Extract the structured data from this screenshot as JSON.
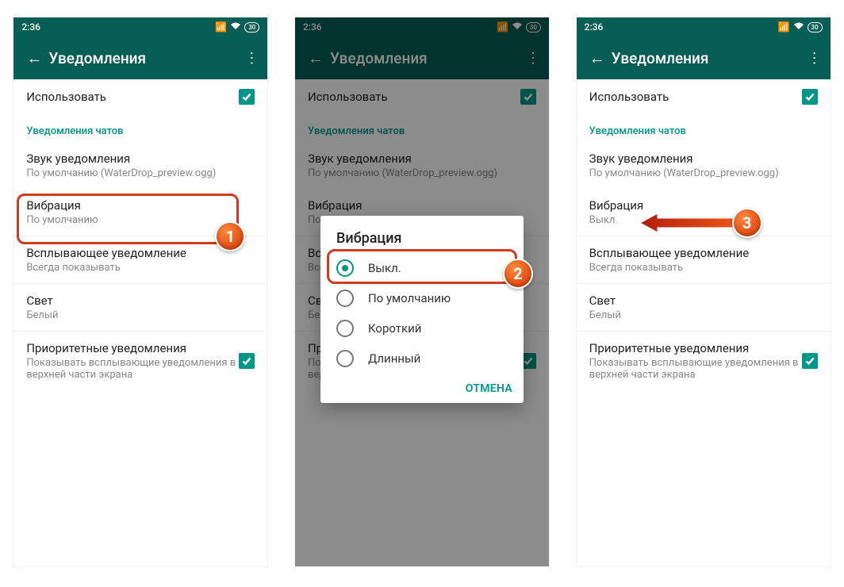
{
  "status": {
    "time": "2:36",
    "battery": "30"
  },
  "appbar": {
    "title": "Уведомления"
  },
  "rows": {
    "use": {
      "label": "Использовать"
    },
    "section_chats": "Уведомления чатов",
    "sound": {
      "label": "Звук уведомления",
      "sub": "По умолчанию (WaterDrop_preview.ogg)"
    },
    "vibration": {
      "label": "Вибрация",
      "sub_default": "По умолчанию",
      "sub_off": "Выкл."
    },
    "popup": {
      "label": "Всплывающее уведомление",
      "sub": "Всегда показывать"
    },
    "light": {
      "label": "Свет",
      "sub": "Белый"
    },
    "priority": {
      "label": "Приоритетные уведомления",
      "sub": "Показывать всплывающие уведомления в верхней части экрана"
    }
  },
  "dialog": {
    "title": "Вибрация",
    "opts": [
      "Выкл.",
      "По умолчанию",
      "Короткий",
      "Длинный"
    ],
    "cancel": "ОТМЕНА"
  },
  "badges": {
    "b1": "1",
    "b2": "2",
    "b3": "3"
  }
}
